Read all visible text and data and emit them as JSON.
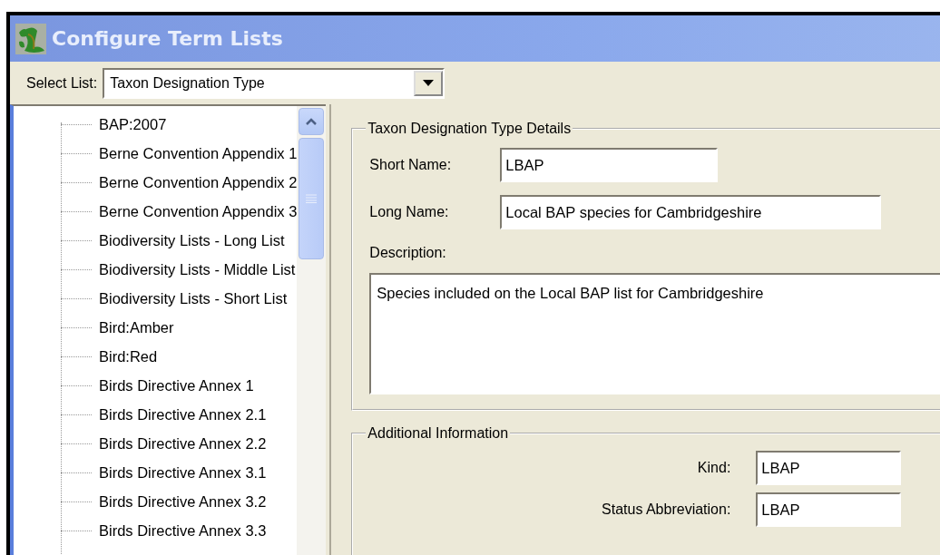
{
  "window": {
    "title": "Configure Term Lists"
  },
  "select_list": {
    "label": "Select List:",
    "value": "Taxon Designation Type"
  },
  "tree": {
    "items": [
      {
        "label": "BAP:2007"
      },
      {
        "label": "Berne Convention Appendix 1"
      },
      {
        "label": "Berne Convention Appendix 2"
      },
      {
        "label": "Berne Convention Appendix 3"
      },
      {
        "label": "Biodiversity Lists - Long List"
      },
      {
        "label": "Biodiversity Lists - Middle List"
      },
      {
        "label": "Biodiversity Lists - Short List"
      },
      {
        "label": "Bird:Amber"
      },
      {
        "label": "Bird:Red"
      },
      {
        "label": "Birds Directive Annex 1"
      },
      {
        "label": "Birds Directive Annex 2.1"
      },
      {
        "label": "Birds Directive Annex 2.2"
      },
      {
        "label": "Birds Directive Annex 3.1"
      },
      {
        "label": "Birds Directive Annex 3.2"
      },
      {
        "label": "Birds Directive Annex 3.3"
      }
    ]
  },
  "details": {
    "title": "Taxon Designation Type Details",
    "short_name": {
      "label": "Short Name:",
      "value": "LBAP"
    },
    "long_name": {
      "label": "Long Name:",
      "value": "Local BAP species for Cambridgeshire"
    },
    "description": {
      "label": "Description:",
      "value": "Species included on the Local BAP list for Cambridgeshire"
    }
  },
  "additional": {
    "title": "Additional Information",
    "fields": [
      {
        "label": "Kind:",
        "value": "LBAP"
      },
      {
        "label": "Status Abbreviation:",
        "value": "LBAP"
      }
    ]
  }
}
